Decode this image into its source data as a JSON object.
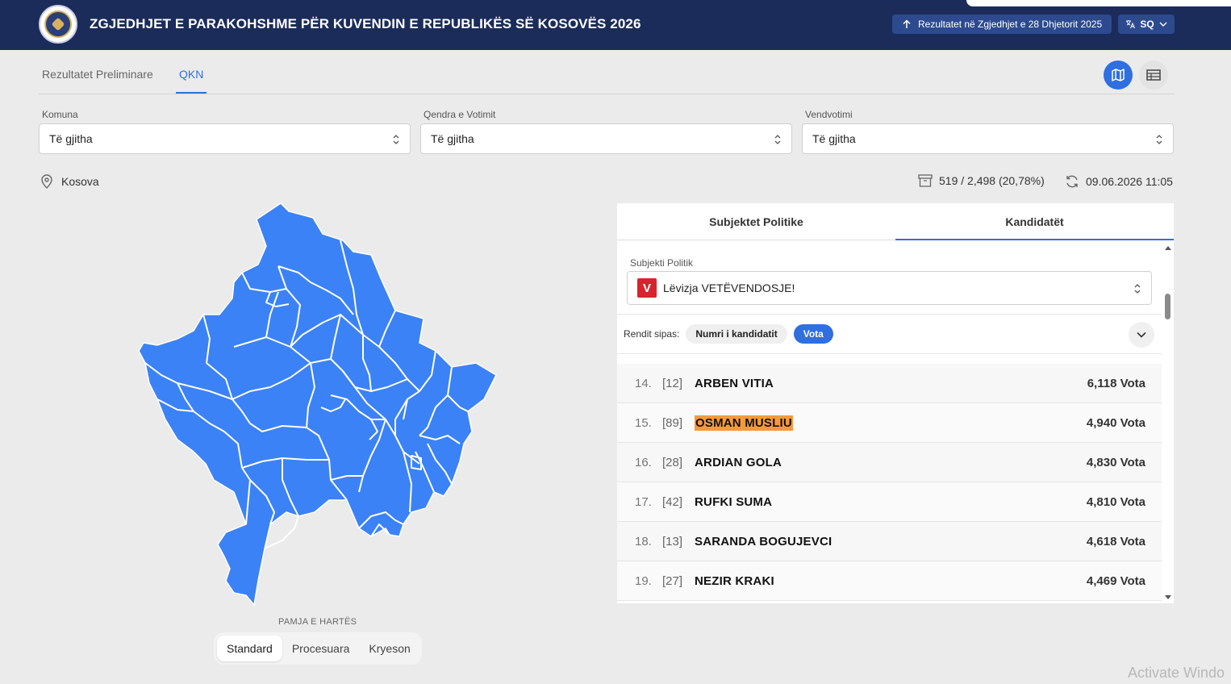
{
  "header": {
    "title": "ZGJEDHJET E PARAKOHSHME PËR KUVENDIN E REPUBLIKËS SË KOSOVËS 2026",
    "results_button": "Rezultatet në Zgjedhjet e 28 Dhjetorit 2025",
    "language": "SQ"
  },
  "tabs": [
    {
      "label": "Rezultatet Preliminare",
      "active": false
    },
    {
      "label": "QKN",
      "active": true
    }
  ],
  "filters": {
    "komuna": {
      "label": "Komuna",
      "value": "Të gjitha"
    },
    "qendra": {
      "label": "Qendra e Votimit",
      "value": "Të gjitha"
    },
    "vendvotimi": {
      "label": "Vendvotimi",
      "value": "Të gjitha"
    }
  },
  "location": "Kosova",
  "stats": {
    "stations": "519 / 2,498 (20,78%)",
    "updated": "09.06.2026 11:05"
  },
  "map": {
    "fill_color": "#3b82f6",
    "border_color": "#ffffff",
    "caption": "PAMJA E HARTËS",
    "view_modes": [
      "Standard",
      "Procesuara",
      "Kryeson"
    ],
    "active_mode": "Standard"
  },
  "panel": {
    "tabs": [
      "Subjektet Politike",
      "Kandidatët"
    ],
    "active_tab": "Kandidatët",
    "party_label": "Subjekti Politik",
    "party_logo": "V",
    "party_name": "Lëvizja VETËVENDOSJE!",
    "sort_label": "Rendit sipas:",
    "sort_options": [
      "Numri i kandidatit",
      "Vota"
    ],
    "active_sort": "Vota",
    "candidates": [
      {
        "rank": "14.",
        "number": "[12]",
        "name": "ARBEN VITIA",
        "votes": "6,118 Vota"
      },
      {
        "rank": "15.",
        "number": "[89]",
        "name": "OSMAN MUSLIU",
        "votes": "4,940 Vota"
      },
      {
        "rank": "16.",
        "number": "[28]",
        "name": "ARDIAN GOLA",
        "votes": "4,830 Vota"
      },
      {
        "rank": "17.",
        "number": "[42]",
        "name": "RUFKI SUMA",
        "votes": "4,810 Vota"
      },
      {
        "rank": "18.",
        "number": "[13]",
        "name": "SARANDA BOGUJEVCI",
        "votes": "4,618 Vota"
      },
      {
        "rank": "19.",
        "number": "[27]",
        "name": "NEZIR KRAKI",
        "votes": "4,469 Vota"
      }
    ]
  },
  "colors": {
    "header_bg": "#1b2b5a",
    "accent": "#2f6fe0",
    "highlight": "#f59a3c",
    "party_red": "#d9232d"
  },
  "watermark": "Activate Windo"
}
